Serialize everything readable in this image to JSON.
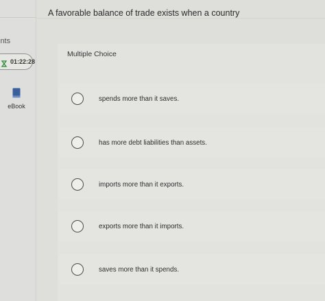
{
  "sidebar": {
    "points_label": "ints",
    "timer": "01:22:28",
    "ebook_label": "eBook"
  },
  "question": {
    "text": "A favorable balance of trade exists when a country"
  },
  "answer": {
    "type_label": "Multiple Choice",
    "choices": [
      "spends more than it saves.",
      "has more debt liabilities than assets.",
      "imports more than it exports.",
      "exports more than it imports.",
      "saves more than it spends."
    ]
  },
  "colors": {
    "background": "#dededb",
    "radio_border": "#4b4b4b",
    "ebook_icon": "#3a5f9c",
    "timer_icon": "#2f8a3a"
  },
  "icons": {
    "timer": "hourglass-icon",
    "ebook": "book-icon",
    "radio": "radio-unselected-icon"
  }
}
